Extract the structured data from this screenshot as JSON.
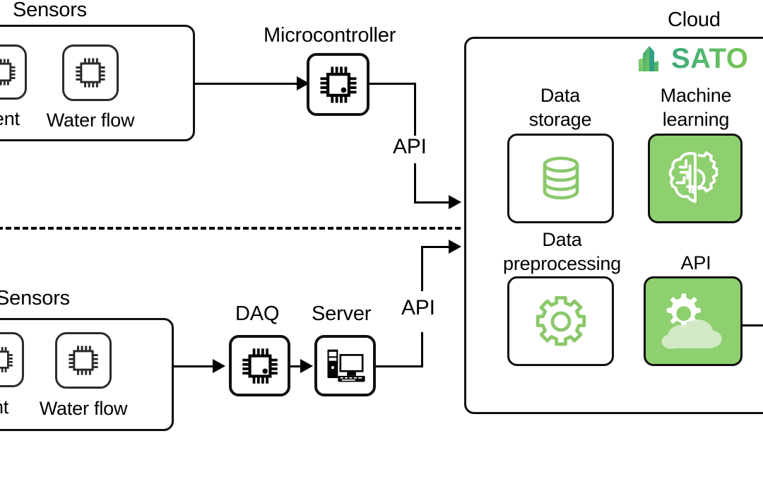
{
  "diagram": {
    "title_edge_sensors_top": "Sensors",
    "title_edge_sensors_bottom": "Sensors",
    "cloud_label": "Cloud",
    "microcontroller_label": "Microcontroller",
    "daq_label": "DAQ",
    "server_label": "Server",
    "api_label_top": "API",
    "api_label_bottom": "API",
    "colors": {
      "accent_green": "#8ecf6f",
      "icon_green": "#8ac86a",
      "logo_green_start": "#3aa87a",
      "logo_green_end": "#79c653",
      "stroke_black": "#111111"
    }
  },
  "sensors_top": {
    "group_title": "Sensors",
    "items": [
      {
        "label": "rent",
        "icon": "chip-icon"
      },
      {
        "label": "Water flow",
        "icon": "chip-icon"
      }
    ]
  },
  "sensors_bottom": {
    "group_title": "Sensors",
    "items": [
      {
        "label": "nt",
        "icon": "chip-icon"
      },
      {
        "label": "Water flow",
        "icon": "chip-icon"
      }
    ]
  },
  "devices": [
    {
      "name": "microcontroller",
      "label": "Microcontroller",
      "icon": "chip-icon"
    },
    {
      "name": "daq",
      "label": "DAQ",
      "icon": "chip-icon"
    },
    {
      "name": "server",
      "label": "Server",
      "icon": "desktop-computer-icon"
    }
  ],
  "cloud": {
    "label": "Cloud",
    "brand": {
      "name": "SATO",
      "icon": "sato-building-icon"
    },
    "tiles": [
      {
        "name": "data-storage",
        "label": "Data\nstorage",
        "caption_line1": "Data",
        "caption_line2": "storage",
        "icon": "database-icon",
        "filled": false
      },
      {
        "name": "machine-learning",
        "label": "Machine\nlearning",
        "caption_line1": "Machine",
        "caption_line2": "learning",
        "icon": "brain-gear-icon",
        "filled": true
      },
      {
        "name": "data-preprocessing",
        "label": "Data\npreprocessing",
        "caption_line1": "Data",
        "caption_line2": "preprocessing",
        "icon": "gear-icon",
        "filled": false
      },
      {
        "name": "cloud-api",
        "label": "API",
        "caption_line1": "API",
        "caption_line2": "",
        "icon": "cloud-gear-icon",
        "filled": true
      }
    ]
  },
  "connections": [
    {
      "from": "sensors_top",
      "to": "microcontroller",
      "label": ""
    },
    {
      "from": "microcontroller",
      "to": "cloud",
      "label": "API"
    },
    {
      "from": "sensors_bottom",
      "to": "daq",
      "label": ""
    },
    {
      "from": "daq",
      "to": "server",
      "label": ""
    },
    {
      "from": "server",
      "to": "cloud",
      "label": "API"
    },
    {
      "from": "cloud-api",
      "to": "external",
      "label": ""
    }
  ]
}
